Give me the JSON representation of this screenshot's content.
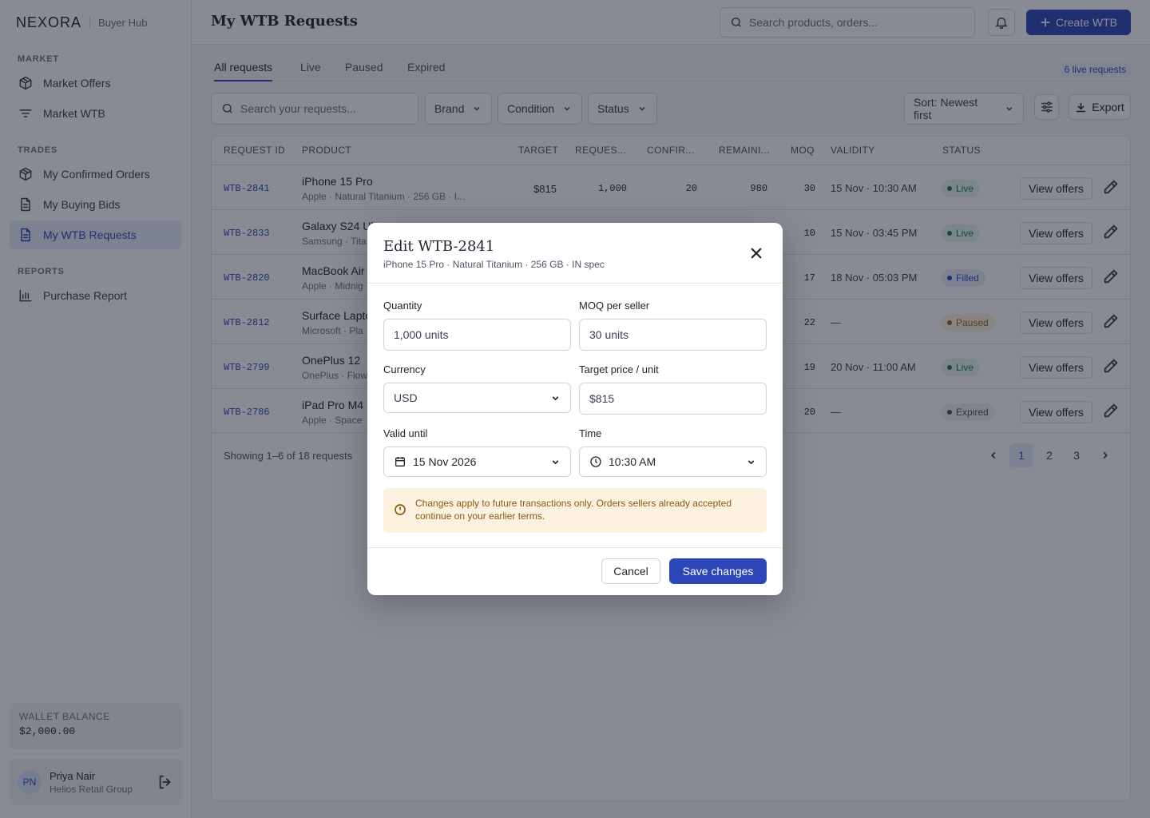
{
  "brand": {
    "logo": "NEXORA",
    "sub": "Buyer Hub"
  },
  "sidebar": {
    "sections": [
      {
        "title": "MARKET",
        "items": [
          {
            "label": "Market Offers",
            "icon": "box-icon"
          },
          {
            "label": "Market WTB",
            "icon": "filter-lines-icon"
          }
        ]
      },
      {
        "title": "TRADES",
        "items": [
          {
            "label": "My Confirmed Orders",
            "icon": "box-icon"
          },
          {
            "label": "My Buying Bids",
            "icon": "document-icon"
          },
          {
            "label": "My WTB Requests",
            "icon": "document-icon",
            "active": true
          }
        ]
      },
      {
        "title": "REPORTS",
        "items": [
          {
            "label": "Purchase Report",
            "icon": "bar-chart-icon"
          }
        ]
      }
    ],
    "wallet": {
      "label": "WALLET BALANCE",
      "value": "$2,000.00"
    },
    "user": {
      "initials": "PN",
      "name": "Priya Nair",
      "org": "Helios Retail Group"
    }
  },
  "topbar": {
    "title": "My WTB Requests",
    "search_placeholder": "Search products, orders...",
    "create_label": "Create WTB"
  },
  "tabs": [
    {
      "label": "All requests",
      "active": true
    },
    {
      "label": "Live"
    },
    {
      "label": "Paused"
    },
    {
      "label": "Expired"
    }
  ],
  "live_count": "6 live requests",
  "filters": {
    "search_placeholder": "Search your requests...",
    "brand": "Brand",
    "condition": "Condition",
    "status": "Status",
    "sort": "Sort: Newest first",
    "export": "Export"
  },
  "table": {
    "headers": [
      "REQUEST ID",
      "PRODUCT",
      "TARGET",
      "REQUES...",
      "CONFIR...",
      "REMAINI...",
      "MOQ",
      "VALIDITY",
      "STATUS"
    ],
    "view_label": "View offers",
    "rows": [
      {
        "id": "WTB-2841",
        "name": "iPhone 15 Pro",
        "sub": "Apple · Natural Titanium · 256 GB · I...",
        "target": "$815",
        "requested": "1,000",
        "confirmed": "20",
        "remaining": "980",
        "moq": "30",
        "validity": "15 Nov · 10:30 AM",
        "status": "Live"
      },
      {
        "id": "WTB-2833",
        "name": "Galaxy S24 Ult",
        "sub": "Samsung · Tita",
        "target": "",
        "requested": "",
        "confirmed": "",
        "remaining": "",
        "moq": "10",
        "validity": "15 Nov · 03:45 PM",
        "status": "Live"
      },
      {
        "id": "WTB-2820",
        "name": "MacBook Air",
        "sub": "Apple · Midnig",
        "target": "",
        "requested": "",
        "confirmed": "",
        "remaining": "",
        "moq": "17",
        "validity": "18 Nov · 05:03 PM",
        "status": "Filled"
      },
      {
        "id": "WTB-2812",
        "name": "Surface Lapto",
        "sub": "Microsoft · Pla",
        "target": "",
        "requested": "",
        "confirmed": "",
        "remaining": "",
        "moq": "22",
        "validity": "—",
        "status": "Paused"
      },
      {
        "id": "WTB-2799",
        "name": "OnePlus 12",
        "sub": "OnePlus · Flow",
        "target": "",
        "requested": "",
        "confirmed": "",
        "remaining": "",
        "moq": "19",
        "validity": "20 Nov · 11:00 AM",
        "status": "Live"
      },
      {
        "id": "WTB-2786",
        "name": "iPad Pro M4",
        "sub": "Apple · Space",
        "target": "",
        "requested": "",
        "confirmed": "",
        "remaining": "",
        "moq": "20",
        "validity": "—",
        "status": "Expired"
      }
    ],
    "showing": "Showing 1–6 of 18 requests",
    "pages": [
      "1",
      "2",
      "3"
    ]
  },
  "status_colors": {
    "Live": "#1f7a3a",
    "Filled": "#2e47b8",
    "Paused": "#9a6a10",
    "Expired": "#4b5563"
  },
  "modal": {
    "title": "Edit WTB-2841",
    "subtitle": "iPhone 15 Pro · Natural Titanium · 256 GB · IN spec",
    "quantity_label": "Quantity",
    "quantity_value": "1,000 units",
    "moq_label": "MOQ per seller",
    "moq_value": "30 units",
    "currency_label": "Currency",
    "currency_value": "USD",
    "price_label": "Target price / unit",
    "price_value": "$815",
    "valid_label": "Valid until",
    "valid_value": "15 Nov 2026",
    "time_label": "Time",
    "time_value": "10:30 AM",
    "notice": "Changes apply to future transactions only. Orders sellers already accepted continue on your earlier terms.",
    "cancel_label": "Cancel",
    "save_label": "Save changes"
  },
  "colors": {
    "accent": "#2e47b8"
  }
}
